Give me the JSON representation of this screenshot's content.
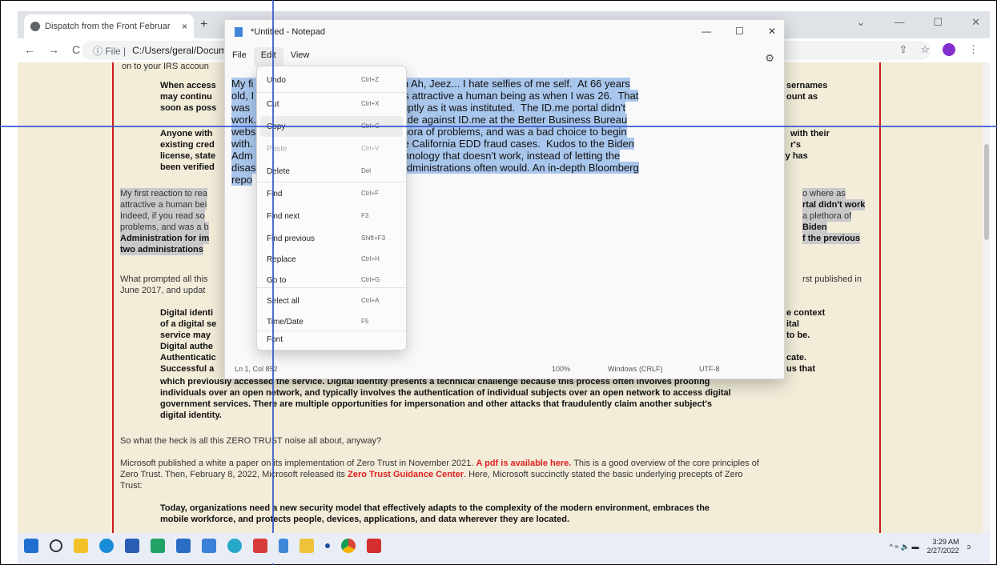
{
  "browser": {
    "tab_title": "Dispatch from the Front Februar",
    "tab_close": "×",
    "new_tab": "+",
    "back": "←",
    "forward": "→",
    "reload": "C",
    "address_info": "ⓘ File |",
    "address": "C:/Users/geral/Documen",
    "window_controls": [
      "⌄",
      "—",
      "☐",
      "✕"
    ]
  },
  "webpage": {
    "lines": [
      {
        "text": "on to your IRS accoun",
        "bold": false
      },
      {
        "text": "When access",
        "bold": true
      },
      {
        "text": "may continu",
        "bold": true
      },
      {
        "text": "soon as poss",
        "bold": true
      },
      {
        "text": "Anyone with",
        "bold": true
      },
      {
        "text": "existing cred",
        "bold": true
      },
      {
        "text": "license, state",
        "bold": true
      },
      {
        "text": "been verified",
        "bold": true
      }
    ],
    "right_fragments": [
      "sernames",
      "ount as",
      "with their",
      "r's",
      "ty has",
      "o where as",
      "rtal didn't work",
      "a plethora of",
      "Biden",
      "f the previous",
      "rst published in",
      "e context",
      "ital",
      "to be.",
      "cate.",
      "us that"
    ],
    "highlight_lines": [
      "My first reaction to rea",
      "attractive a human bei",
      "Indeed, if you read so",
      "problems, and was a b",
      "Administration for im",
      "two administrations"
    ],
    "what_prompted": "What prompted all this",
    "june": "June 2017, and updat",
    "digital_lines": [
      "Digital identi",
      "of a digital se",
      "service may",
      "Digital authe",
      "Authenticatic",
      "Successful a"
    ],
    "para_full": [
      "which previously accessed the service. Digital identity presents a technical challenge because this process often involves proofing",
      "individuals over an open network, and typically involves the authentication of individual subjects over an open network to access digital",
      "government services. There are multiple opportunities for impersonation and other attacks that fraudulently claim another subject's",
      "digital identity."
    ],
    "zero_trust_q": "So what the heck is all this ZERO TRUST noise all about, anyway?",
    "ms_line1_a": "Microsoft published a white a paper on its implementation of Zero Trust in November 2021.",
    "ms_line1_link": "A pdf is available here.",
    "ms_line1_b": "This is a good overview of the core principles of",
    "ms_line2_a": "Zero Trust.  Then, February 8, 2022, Microsoft released its",
    "ms_line2_link": "Zero Trust Guidance Center",
    "ms_line2_b": ".  Here, Microsoft succinctly stated the basic underlying precepts of Zero",
    "ms_line3": "Trust:",
    "quote1": "Today, organizations need a new security model that effectively adapts to the complexity of the modern environment, embraces the",
    "quote2": "mobile workforce, and protects people, devices, applications, and data wherever they are located."
  },
  "notepad": {
    "title": "*Untitled - Notepad",
    "controls": [
      "—",
      "☐",
      "✕"
    ],
    "menu": [
      "File",
      "Edit",
      "View"
    ],
    "gear": "⚙",
    "text_lines": [
      "My fi                    ews was pretty much Ah, Jeez... I hate selfies of me self.  At 66 years",
      "old, I                    hat I am no where as attractive a human being as when I was 26.  That",
      "was                     was dropped as abruptly as it was instituted.  The ID.me portal didn't",
      "work.                   of the complaints made against ID.me at the Better Business Bureau",
      "webs                   me portal has a plethora of problems, and was a bad choice to begin",
      "with.                   s are implicated in the California EDD fraud cases.  Kudos to the Biden",
      "Adm                   ulling the plug on technology that doesn't work, instead of letting the",
      "disas                   of the previous two administrations often would. An in-depth Bloomberg",
      "repo"
    ],
    "status": {
      "position": "Ln 1, Col 852",
      "zoom": "100%",
      "line_ending": "Windows (CRLF)",
      "encoding": "UTF-8"
    }
  },
  "edit_menu": [
    {
      "label": "Undo",
      "shortcut": "Ctrl+Z",
      "disabled": false
    },
    {
      "label": "Cut",
      "shortcut": "Ctrl+X",
      "disabled": false
    },
    {
      "label": "Copy",
      "shortcut": "Ctrl+C",
      "disabled": false
    },
    {
      "label": "Paste",
      "shortcut": "Ctrl+V",
      "disabled": true
    },
    {
      "label": "Delete",
      "shortcut": "Del",
      "disabled": false
    },
    {
      "label": "Find",
      "shortcut": "Ctrl+F",
      "disabled": false
    },
    {
      "label": "Find next",
      "shortcut": "F3",
      "disabled": false
    },
    {
      "label": "Find previous",
      "shortcut": "Shift+F3",
      "disabled": false
    },
    {
      "label": "Replace",
      "shortcut": "Ctrl+H",
      "disabled": false
    },
    {
      "label": "Go to",
      "shortcut": "Ctrl+G",
      "disabled": false
    },
    {
      "label": "Select all",
      "shortcut": "Ctrl+A",
      "disabled": false
    },
    {
      "label": "Time/Date",
      "shortcut": "F5",
      "disabled": false
    },
    {
      "label": "Font",
      "shortcut": "",
      "disabled": false
    }
  ],
  "taskbar": {
    "icons": [
      "windows-start",
      "search",
      "file-explorer",
      "edge",
      "store",
      "app-green",
      "app-blue",
      "app-blue2",
      "app-teal",
      "app-red",
      "notepad",
      "app-folder",
      "dot",
      "chrome",
      "acrobat"
    ],
    "tray_icons": "^  ≈  🔈  ▬",
    "time": "3:29 AM",
    "date": "2/27/2022",
    "notif": "ↄ"
  },
  "colors": {
    "page_bg": "#f2ecd9",
    "red_rule": "#cc1a1a",
    "selection": "#a9c6ec",
    "crosshair": "#3355cc",
    "link_red": "#e02020"
  }
}
